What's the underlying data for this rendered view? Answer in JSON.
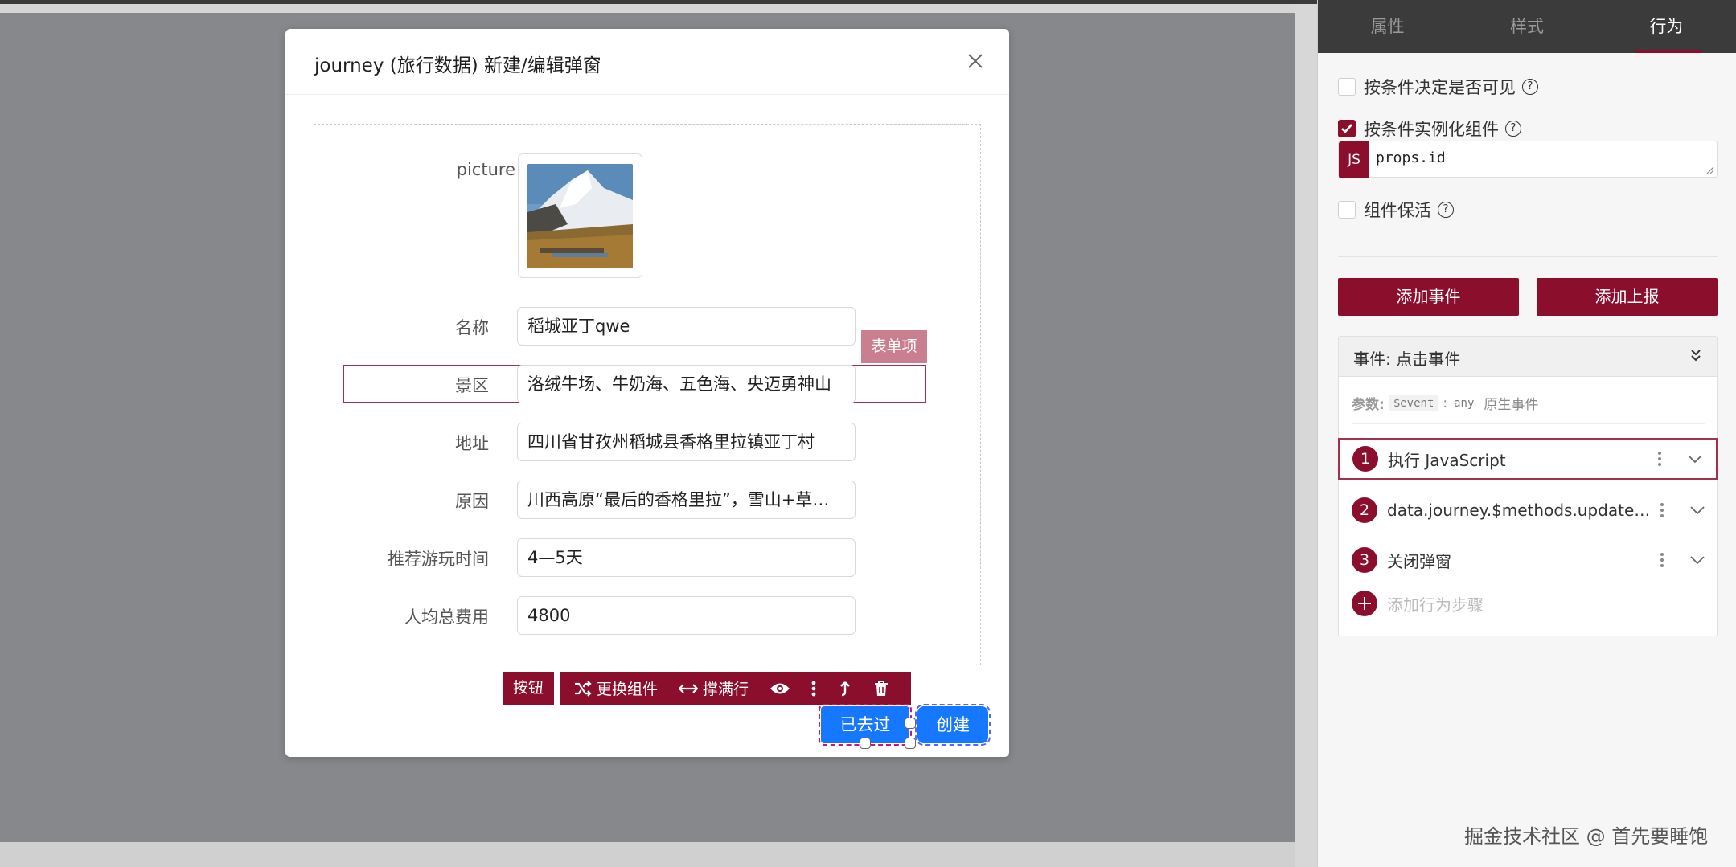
{
  "modal": {
    "title": "journey (旅行数据) 新建/编辑弹窗",
    "picture_label": "picture",
    "fields": [
      {
        "label": "名称",
        "value": "稻城亚丁qwe"
      },
      {
        "label": "景区",
        "value": "洛绒牛场、牛奶海、五色海、央迈勇神山"
      },
      {
        "label": "地址",
        "value": "四川省甘孜州稻城县香格里拉镇亚丁村"
      },
      {
        "label": "原因",
        "value": "川西高原“最后的香格里拉”，雪山+草甸+湖泊…"
      },
      {
        "label": "推荐游玩时间",
        "value": "4—5天"
      },
      {
        "label": "人均总费用",
        "value": "4800"
      }
    ],
    "form_item_tag": "表单项"
  },
  "toolbar": {
    "component_tag": "按钮",
    "replace_label": "更换组件",
    "stretch_label": "撑满行"
  },
  "buttons": {
    "visited": "已去过",
    "create": "创建"
  },
  "panel": {
    "tabs": [
      "属性",
      "样式",
      "行为"
    ],
    "active_tab": "行为",
    "options": {
      "conditional_visible": "按条件决定是否可见",
      "conditional_instantiate": "按条件实例化组件",
      "keep_alive": "组件保活"
    },
    "js_badge": "JS",
    "js_code": "props.id",
    "add_event": "添加事件",
    "add_report": "添加上报",
    "event": {
      "title": "事件: 点击事件",
      "params_label": "参数:",
      "param_name": "$event",
      "param_type": "any",
      "param_desc": "原生事件",
      "steps": [
        {
          "num": "1",
          "text": "执行 JavaScript"
        },
        {
          "num": "2",
          "text": "data.journey.$methods.update (arg..."
        },
        {
          "num": "3",
          "text": "关闭弹窗"
        }
      ],
      "add_step": "添加行为步骤"
    }
  },
  "watermark": "掘金技术社区 @ 首先要睡饱",
  "colors": {
    "brand": "#8b0e2d",
    "primary_button": "#1677ff"
  }
}
